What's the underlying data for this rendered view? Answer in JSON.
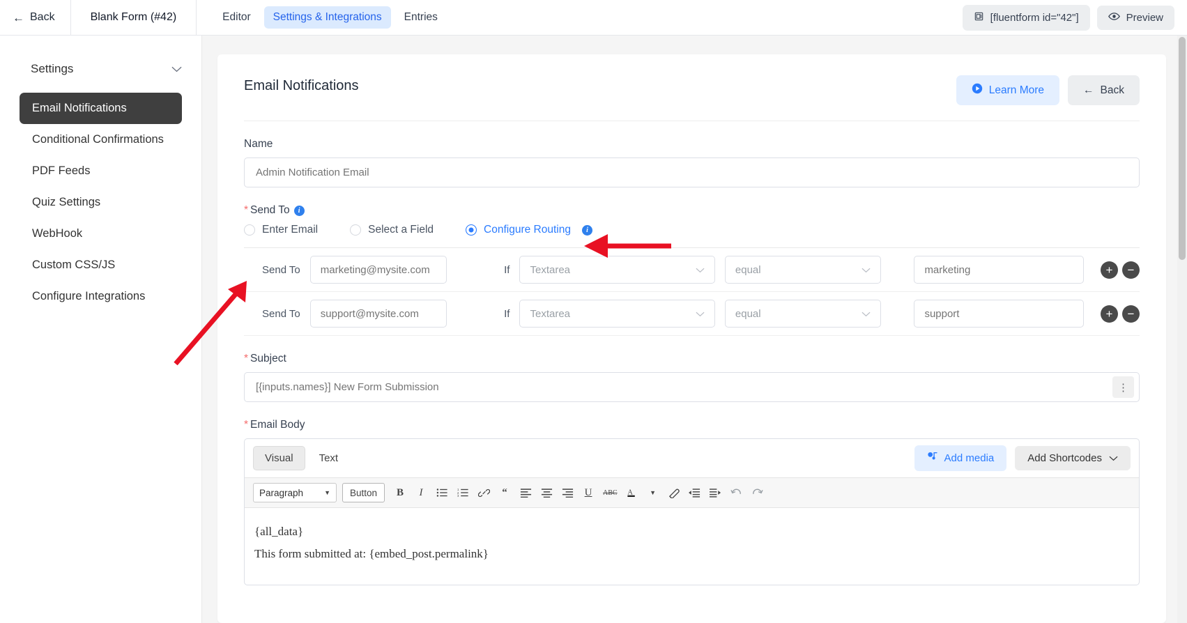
{
  "topbar": {
    "back_label": "Back",
    "form_name": "Blank Form (#42)",
    "tabs": [
      {
        "label": "Editor",
        "active": false
      },
      {
        "label": "Settings & Integrations",
        "active": true
      },
      {
        "label": "Entries",
        "active": false
      }
    ],
    "shortcode": "[fluentform id=\"42\"]",
    "preview_label": "Preview"
  },
  "sidebar": {
    "heading": "Settings",
    "items": [
      {
        "label": "Email Notifications",
        "active": true
      },
      {
        "label": "Conditional Confirmations",
        "active": false
      },
      {
        "label": "PDF Feeds",
        "active": false
      },
      {
        "label": "Quiz Settings",
        "active": false
      },
      {
        "label": "WebHook",
        "active": false
      },
      {
        "label": "Custom CSS/JS",
        "active": false
      },
      {
        "label": "Configure Integrations",
        "active": false
      }
    ]
  },
  "panel": {
    "title": "Email Notifications",
    "learn_more_label": "Learn More",
    "back_label": "Back"
  },
  "form": {
    "name_label": "Name",
    "name_placeholder": "Admin Notification Email",
    "send_to_label": "Send To",
    "send_to_options": [
      {
        "label": "Enter Email",
        "selected": false
      },
      {
        "label": "Select a Field",
        "selected": false
      },
      {
        "label": "Configure Routing",
        "selected": true,
        "info": true
      }
    ],
    "routing": {
      "send_to_label": "Send To",
      "if_label": "If",
      "rows": [
        {
          "email": "marketing@mysite.com",
          "field": "Textarea",
          "operator": "equal",
          "value": "marketing",
          "add": "+",
          "remove": "−"
        },
        {
          "email": "support@mysite.com",
          "field": "Textarea",
          "operator": "equal",
          "value": "support",
          "add": "+",
          "remove": "−"
        }
      ]
    },
    "subject_label": "Subject",
    "subject_value": "[{inputs.names}] New Form Submission",
    "subject_menu_icon": "⋮",
    "email_body_label": "Email Body",
    "editor": {
      "tabs": [
        {
          "label": "Visual",
          "active": true
        },
        {
          "label": "Text",
          "active": false
        }
      ],
      "add_media_label": "Add media",
      "add_shortcodes_label": "Add Shortcodes",
      "format_select": "Paragraph",
      "button_label": "Button",
      "toolbar_icons": [
        "bold-icon",
        "italic-icon",
        "bullet-list-icon",
        "numbered-list-icon",
        "link-icon",
        "blockquote-icon",
        "align-left-icon",
        "align-center-icon",
        "align-right-icon",
        "underline-icon",
        "strikethrough-icon",
        "text-color-icon",
        "clear-formatting-icon",
        "outdent-icon",
        "indent-icon",
        "undo-icon",
        "redo-icon"
      ],
      "body_lines": [
        "{all_data}",
        "This form submitted at: {embed_post.permalink}"
      ]
    }
  },
  "colors": {
    "accent_blue": "#2b7cff",
    "accent_bg": "#e4efff",
    "active_sidebar": "#3f3f3f",
    "required_red": "#f56c6c",
    "annotation_red": "#e81123"
  }
}
